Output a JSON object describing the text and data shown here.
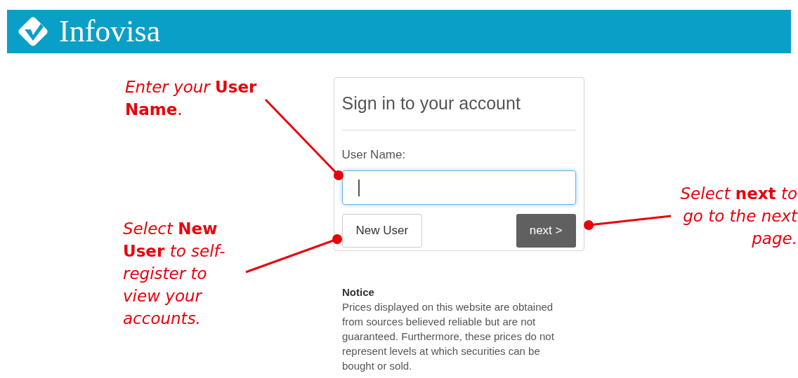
{
  "header": {
    "logo_text": "Infovisa"
  },
  "signin": {
    "title": "Sign in to your account",
    "field_label": "User Name:",
    "field_focused": true,
    "buttons": [
      {
        "label": "New User",
        "kind": "secondary"
      },
      {
        "label": "next >",
        "kind": "primary"
      }
    ]
  },
  "notice": {
    "title": "Notice",
    "body": "Prices displayed on this website are obtained from sources believed reliable but are not guaranteed. Furthermore, these prices do not represent levels at which securities can be bought or sold."
  },
  "callouts": [
    {
      "text": "*Enter your* **User Name**."
    },
    {
      "text": "*Select* **New User** *to self-register to view your accounts.*"
    },
    {
      "text": "*Select* **next** *to go to the next page.*"
    }
  ]
}
